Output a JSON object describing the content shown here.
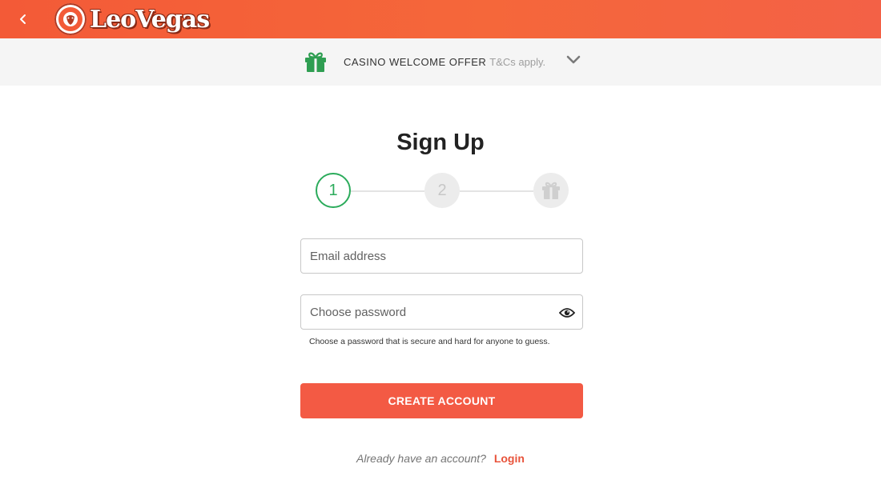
{
  "header": {
    "brand": "LeoVegas",
    "back_icon": "chevron-left-icon",
    "logo_icon": "lion-head-icon",
    "accent_color": "#f35a37"
  },
  "offer": {
    "icon": "gift-icon",
    "icon_color": "#2f9e52",
    "title": "CASINO WELCOME OFFER",
    "terms": "T&Cs apply.",
    "expand_icon": "chevron-down-icon"
  },
  "signup": {
    "title": "Sign Up",
    "steps": [
      {
        "label": "1",
        "state": "active"
      },
      {
        "label": "2",
        "state": "inactive"
      },
      {
        "label": "",
        "icon": "gift-icon",
        "state": "inactive"
      }
    ],
    "active_step_color": "#2bab5b",
    "email": {
      "placeholder": "Email address",
      "value": ""
    },
    "password": {
      "placeholder": "Choose password",
      "value": "",
      "toggle_icon": "eye-icon",
      "hint": "Choose a password that is secure and hard for anyone to guess."
    },
    "create_button": "CREATE ACCOUNT",
    "button_color": "#f35a44",
    "login_prompt": "Already have an account?",
    "login_link": "Login"
  }
}
